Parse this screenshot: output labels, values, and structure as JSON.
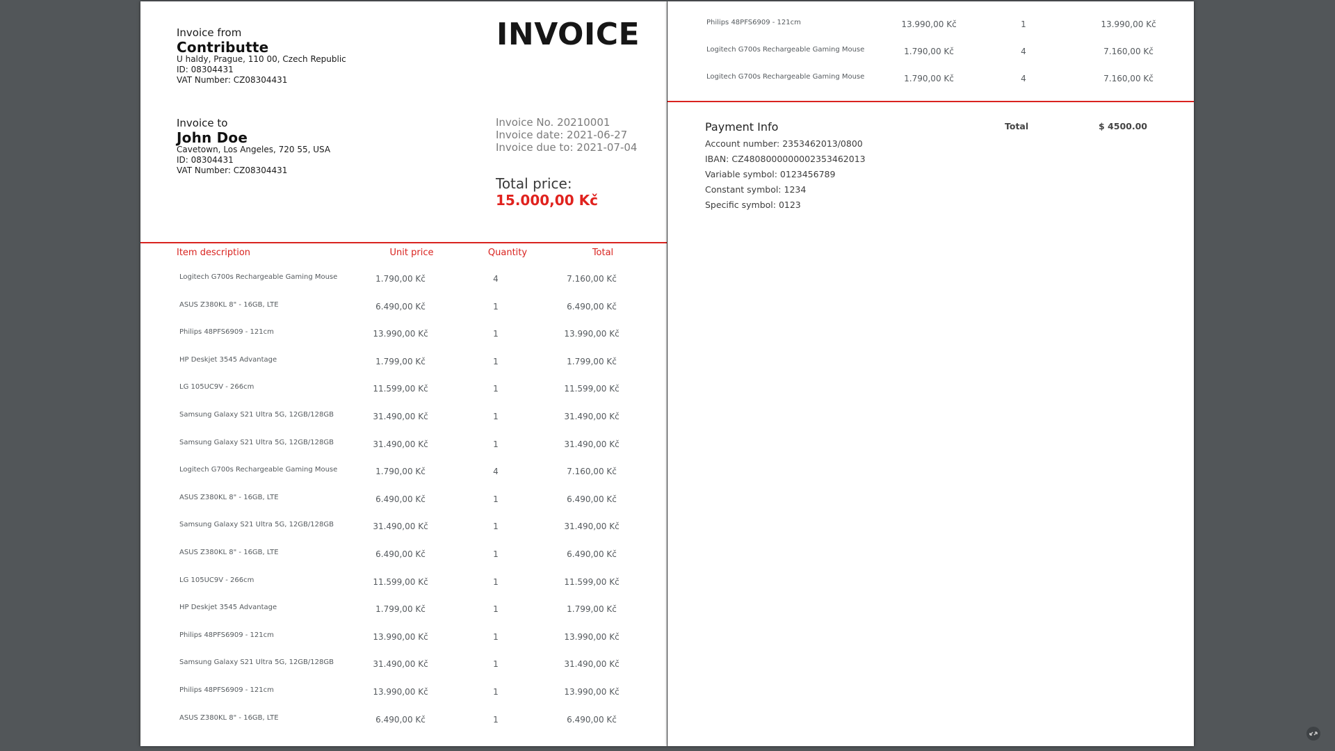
{
  "invoice": {
    "from_label": "Invoice from",
    "company": "Contributte",
    "company_address": "U haldy, Prague, 110 00, Czech Republic",
    "company_id": "ID: 08304431",
    "company_vat": "VAT Number: CZ08304431",
    "title": "INVOICE",
    "to_label": "Invoice to",
    "client": "John Doe",
    "client_address": "Cavetown, Los Angeles, 720 55, USA",
    "client_id": "ID: 08304431",
    "client_vat": "VAT Number: CZ08304431",
    "number": "Invoice No. 20210001",
    "date": "Invoice date: 2021-06-27",
    "due": "Invoice due to: 2021-07-04",
    "total_price_label": "Total price:",
    "total_price_value": "15.000,00 Kč"
  },
  "table": {
    "headers": {
      "description": "Item description",
      "unit_price": "Unit price",
      "quantity": "Quantity",
      "total": "Total"
    },
    "rows_page1": [
      {
        "desc": "Logitech G700s Rechargeable Gaming Mouse",
        "unit": "1.790,00 Kč",
        "qty": "4",
        "total": "7.160,00 Kč"
      },
      {
        "desc": "ASUS Z380KL 8\" - 16GB, LTE",
        "unit": "6.490,00 Kč",
        "qty": "1",
        "total": "6.490,00 Kč"
      },
      {
        "desc": "Philips 48PFS6909 - 121cm",
        "unit": "13.990,00 Kč",
        "qty": "1",
        "total": "13.990,00 Kč"
      },
      {
        "desc": "HP Deskjet 3545 Advantage",
        "unit": "1.799,00 Kč",
        "qty": "1",
        "total": "1.799,00 Kč"
      },
      {
        "desc": "LG 105UC9V - 266cm",
        "unit": "11.599,00 Kč",
        "qty": "1",
        "total": "11.599,00 Kč"
      },
      {
        "desc": "Samsung Galaxy S21 Ultra 5G, 12GB/128GB",
        "unit": "31.490,00 Kč",
        "qty": "1",
        "total": "31.490,00 Kč"
      },
      {
        "desc": "Samsung Galaxy S21 Ultra 5G, 12GB/128GB",
        "unit": "31.490,00 Kč",
        "qty": "1",
        "total": "31.490,00 Kč"
      },
      {
        "desc": "Logitech G700s Rechargeable Gaming Mouse",
        "unit": "1.790,00 Kč",
        "qty": "4",
        "total": "7.160,00 Kč"
      },
      {
        "desc": "ASUS Z380KL 8\" - 16GB, LTE",
        "unit": "6.490,00 Kč",
        "qty": "1",
        "total": "6.490,00 Kč"
      },
      {
        "desc": "Samsung Galaxy S21 Ultra 5G, 12GB/128GB",
        "unit": "31.490,00 Kč",
        "qty": "1",
        "total": "31.490,00 Kč"
      },
      {
        "desc": "ASUS Z380KL 8\" - 16GB, LTE",
        "unit": "6.490,00 Kč",
        "qty": "1",
        "total": "6.490,00 Kč"
      },
      {
        "desc": "LG 105UC9V - 266cm",
        "unit": "11.599,00 Kč",
        "qty": "1",
        "total": "11.599,00 Kč"
      },
      {
        "desc": "HP Deskjet 3545 Advantage",
        "unit": "1.799,00 Kč",
        "qty": "1",
        "total": "1.799,00 Kč"
      },
      {
        "desc": "Philips 48PFS6909 - 121cm",
        "unit": "13.990,00 Kč",
        "qty": "1",
        "total": "13.990,00 Kč"
      },
      {
        "desc": "Samsung Galaxy S21 Ultra 5G, 12GB/128GB",
        "unit": "31.490,00 Kč",
        "qty": "1",
        "total": "31.490,00 Kč"
      },
      {
        "desc": "Philips 48PFS6909 - 121cm",
        "unit": "13.990,00 Kč",
        "qty": "1",
        "total": "13.990,00 Kč"
      },
      {
        "desc": "ASUS Z380KL 8\" - 16GB, LTE",
        "unit": "6.490,00 Kč",
        "qty": "1",
        "total": "6.490,00 Kč"
      }
    ],
    "rows_page2": [
      {
        "desc": "Philips 48PFS6909 - 121cm",
        "unit": "13.990,00 Kč",
        "qty": "1",
        "total": "13.990,00 Kč"
      },
      {
        "desc": "Logitech G700s Rechargeable Gaming Mouse",
        "unit": "1.790,00 Kč",
        "qty": "4",
        "total": "7.160,00 Kč"
      },
      {
        "desc": "Logitech G700s Rechargeable Gaming Mouse",
        "unit": "1.790,00 Kč",
        "qty": "4",
        "total": "7.160,00 Kč"
      }
    ]
  },
  "payment": {
    "title": "Payment Info",
    "account": "Account number: 2353462013/0800",
    "iban": "IBAN: CZ4808000000002353462013",
    "variable": "Variable symbol: 0123456789",
    "constant": "Constant symbol: 1234",
    "specific": "Specific symbol: 0123",
    "total_label": "Total",
    "total_value": "$ 4500.00"
  },
  "colors": {
    "accent": "#d9231f",
    "total_price": "#e0221e",
    "viewer_background": "#525659"
  },
  "icons": {
    "corner": "fit-to-page-icon"
  }
}
